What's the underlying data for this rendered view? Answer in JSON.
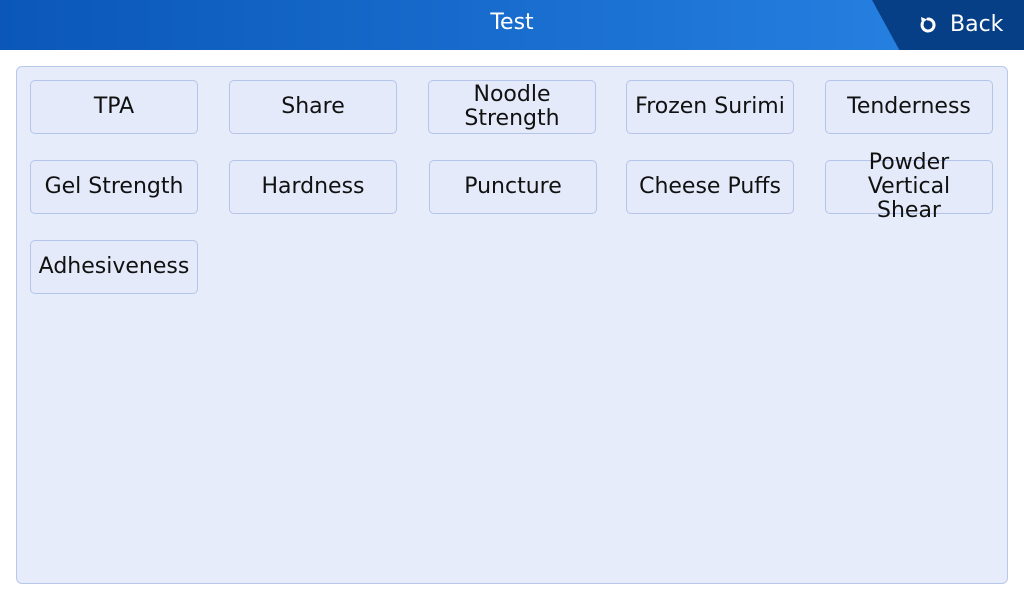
{
  "header": {
    "title": "Test",
    "back_label": "Back"
  },
  "tests": [
    "TPA",
    "Share",
    "Noodle\nStrength",
    "Frozen Surimi",
    "Tenderness",
    "Gel Strength",
    "Hardness",
    "Puncture",
    "Cheese Puffs",
    "Powder Vertical\nShear",
    "Adhesiveness"
  ],
  "colors": {
    "header_start": "#0a57b8",
    "header_end": "#2a86e6",
    "back_button": "#073f86",
    "panel": "#e6ecfa",
    "button_border": "#b5c5e9"
  }
}
